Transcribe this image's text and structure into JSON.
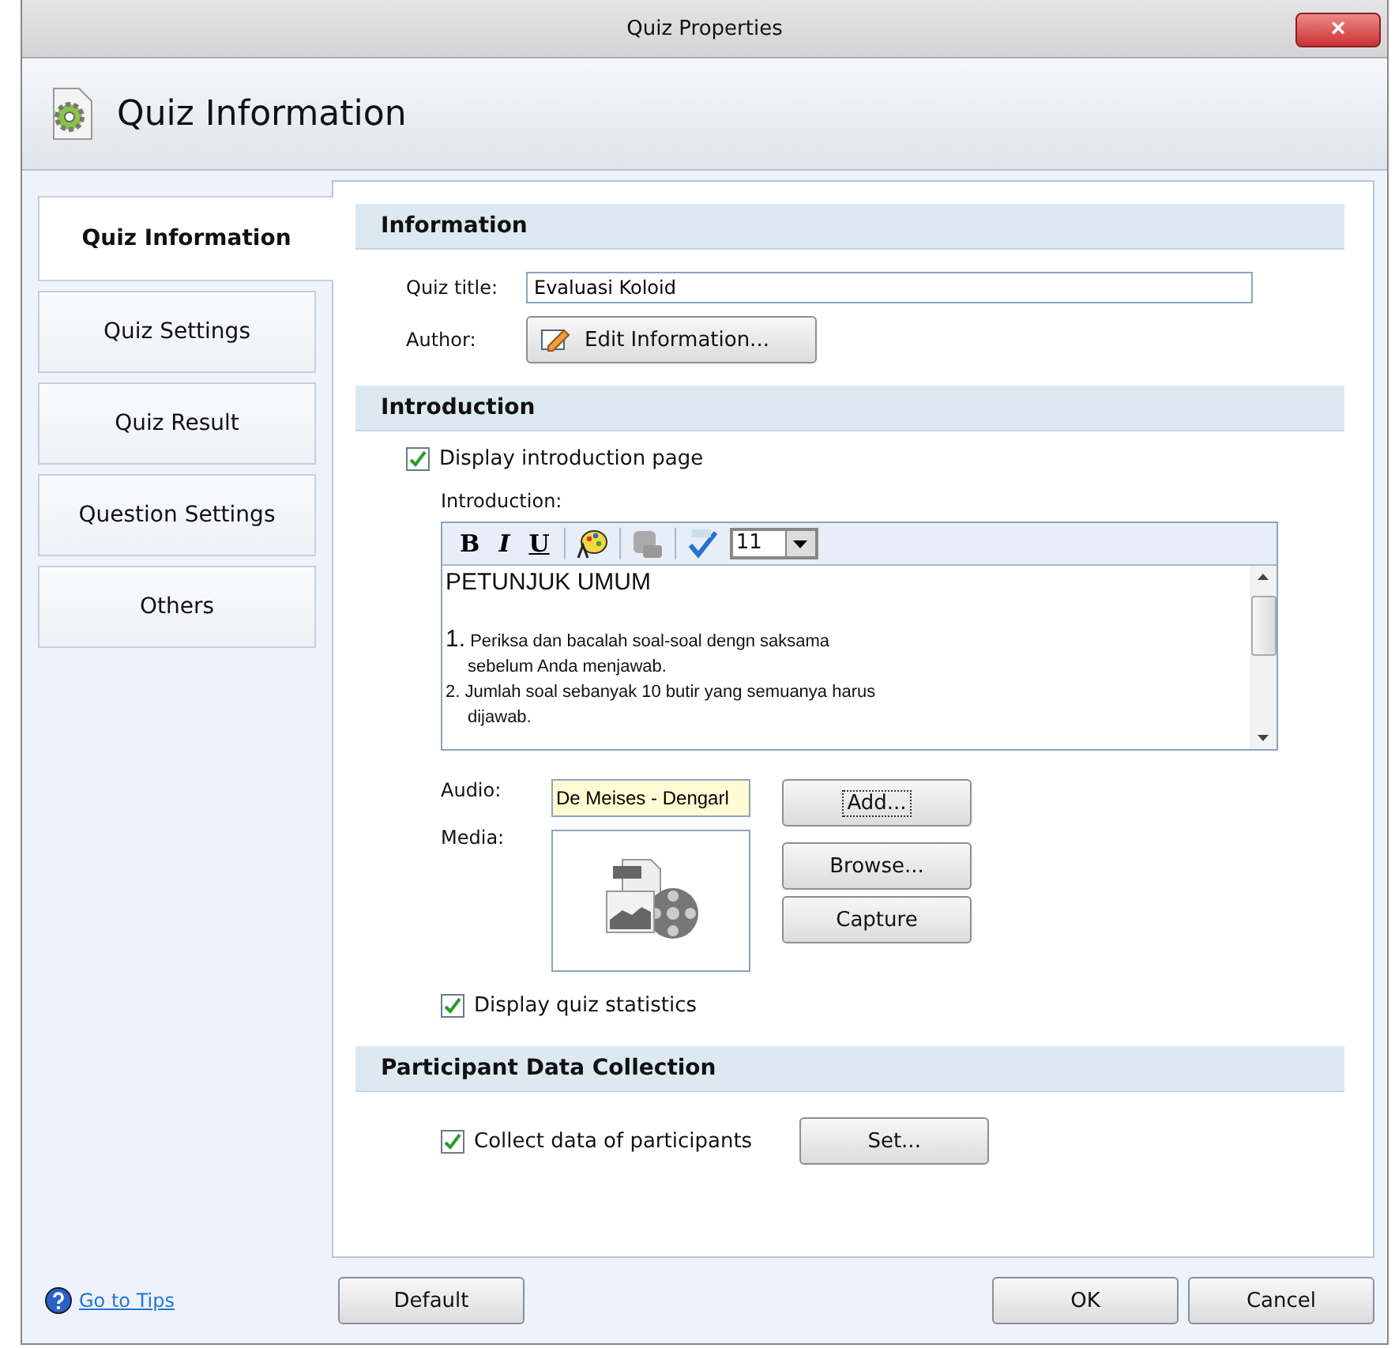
{
  "window": {
    "title": "Quiz Properties",
    "close": "×"
  },
  "header": {
    "title": "Quiz Information"
  },
  "sidebar": {
    "items": [
      {
        "label": "Quiz Information",
        "selected": true
      },
      {
        "label": "Quiz Settings",
        "selected": false
      },
      {
        "label": "Quiz Result",
        "selected": false
      },
      {
        "label": "Question Settings",
        "selected": false
      },
      {
        "label": "Others",
        "selected": false
      }
    ]
  },
  "information": {
    "heading": "Information",
    "title_label": "Quiz title:",
    "title_value": "Evaluasi Koloid",
    "author_label": "Author:",
    "author_button": "Edit Information..."
  },
  "introduction": {
    "heading": "Introduction",
    "display_label": "Display introduction page",
    "display_checked": true,
    "editor_label": "Introduction:",
    "toolbar": {
      "bold": "B",
      "italic": "I",
      "underline": "U",
      "font_size": "11"
    },
    "content": {
      "heading": "PETUNJUK UMUM",
      "items": [
        {
          "number": "1.",
          "large_number": true,
          "text": "Periksa dan bacalah soal-soal dengn saksama sebelum Anda menjawab."
        },
        {
          "number": "2.",
          "large_number": false,
          "text": "Jumlah soal sebanyak 10 butir yang semuanya harus dijawab."
        }
      ]
    },
    "audio_label": "Audio:",
    "audio_value": "De Meises - Dengarl",
    "add_button": "Add...",
    "media_label": "Media:",
    "browse_button": "Browse...",
    "capture_button": "Capture",
    "stats_label": "Display quiz statistics",
    "stats_checked": true
  },
  "participants": {
    "heading": "Participant Data Collection",
    "collect_label": "Collect data of participants",
    "collect_checked": true,
    "set_button": "Set..."
  },
  "footer": {
    "tips": "Go to Tips",
    "default_button": "Default",
    "ok_button": "OK",
    "cancel_button": "Cancel"
  }
}
